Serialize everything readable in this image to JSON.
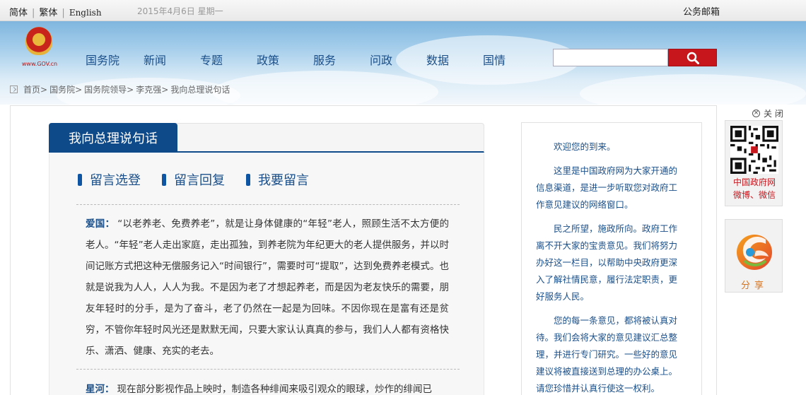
{
  "topbar": {
    "lang_simplified": "简体",
    "lang_traditional": "繁体",
    "lang_english": "English",
    "date": "2015年4月6日 星期一",
    "mail": "公务邮箱"
  },
  "header": {
    "logo_text": "www.GOV.cn",
    "nav": [
      "国务院",
      "新闻",
      "专题",
      "政策",
      "服务",
      "问政",
      "数据",
      "国情"
    ],
    "search": {
      "placeholder": ""
    }
  },
  "breadcrumb": [
    "首页",
    "国务院",
    "国务院领导",
    "李克强",
    "我向总理说句话"
  ],
  "breadcrumb_sep": ">",
  "tab": {
    "active": "我向总理说句话"
  },
  "subnav": [
    "留言选登",
    "留言回复",
    "我要留言"
  ],
  "messages": [
    {
      "author": "爱国：",
      "text": "“以老养老、免费养老”，就是让身体健康的“年轻”老人，照顾生活不太方便的老人。“年轻”老人走出家庭，走出孤独，到养老院为年纪更大的老人提供服务，并以时间记账方式把这种无偿服务记入“时间银行”，需要时可“提取”，达到免费养老模式。也就是说我为人人，人人为我。不是因为老了才想起养老，而是因为老友快乐的需要，朋友年轻时的分手，是为了奋斗，老了仍然在一起是为回味。不因你现在是富有还是贫穷，不管你年轻时风光还是默默无闻，只要大家认认真真的参与，我们人人都有资格快乐、潇洒、健康、充实的老去。"
    },
    {
      "author": "星河：",
      "text": "现在部分影视作品上映时，制造各种绯闻来吸引观众的眼球，炒作的绯闻已"
    }
  ],
  "welcome": [
    "欢迎您的到来。",
    "这里是中国政府网为大家开通的信息渠道，是进一步听取您对政府工作意见建议的网络窗口。",
    "民之所望，施政所向。政府工作离不开大家的宝贵意见。我们将努力办好这一栏目，以帮助中央政府更深入了解社情民意，履行法定职责，更好服务人民。",
    "您的每一条意见，都将被认真对待。我们会将大家的意见建议汇总整理，并进行专门研究。一些好的意见建议将被直接送到总理的办公桌上。请您珍惜并认真行使这一权利。"
  ],
  "side": {
    "close": "关 闭",
    "qr_label_1": "中国政府网",
    "qr_label_2": "微博、微信",
    "share": "分享"
  },
  "colors": {
    "brand_blue": "#0e4a8a",
    "brand_red": "#c8161d",
    "link_blue": "#1a4f8a"
  }
}
